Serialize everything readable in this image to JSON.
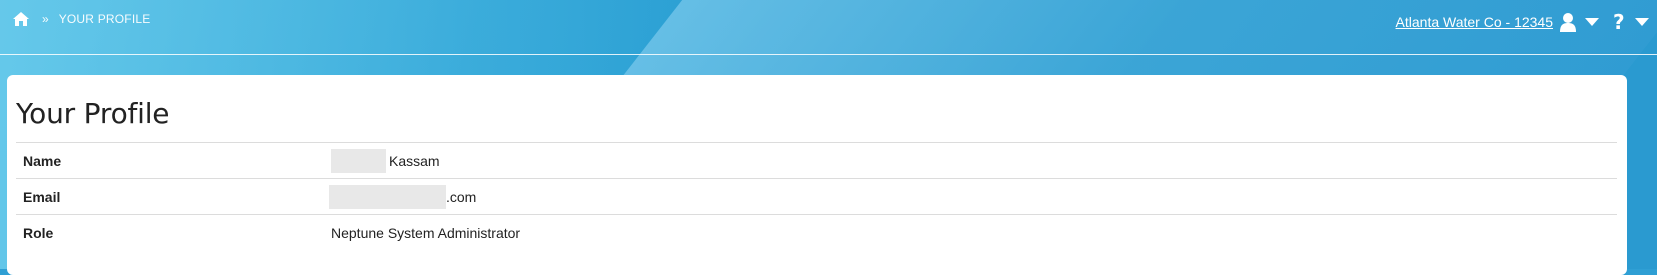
{
  "breadcrumb": {
    "home_icon": "home-icon",
    "separator": "»",
    "current": "YOUR PROFILE"
  },
  "header": {
    "account_label": "Atlanta Water Co - 12345",
    "user_icon": "user-icon",
    "help_icon_text": "?"
  },
  "page": {
    "title": "Your Profile"
  },
  "profile": {
    "rows": [
      {
        "label": "Name",
        "value": "Kassam"
      },
      {
        "label": "Email",
        "value": ".com"
      },
      {
        "label": "Role",
        "value": "Neptune System Administrator"
      }
    ]
  },
  "colors": {
    "background_blue": "#2f9fd4",
    "card": "#ffffff",
    "text": "#222222"
  }
}
